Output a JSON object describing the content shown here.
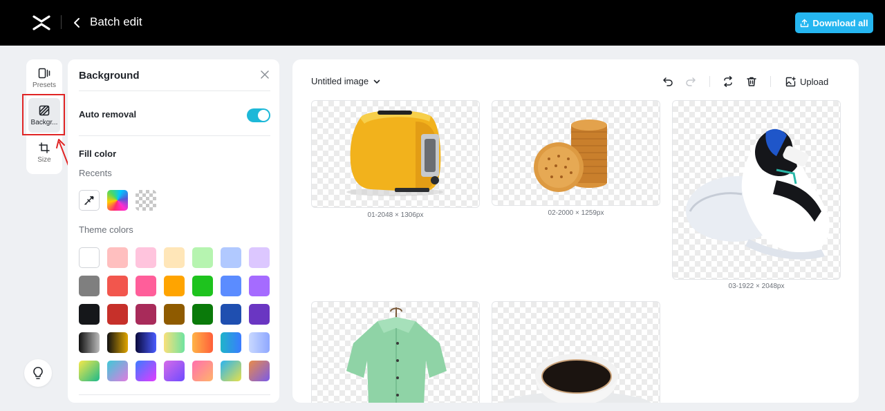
{
  "header": {
    "title": "Batch edit",
    "download_label": "Download all"
  },
  "rail": {
    "presets_label": "Presets",
    "background_label": "Backgr...",
    "size_label": "Size"
  },
  "panel": {
    "title": "Background",
    "auto_removal_label": "Auto removal",
    "auto_removal_on": true,
    "fill_color_label": "Fill color",
    "recents_label": "Recents",
    "theme_colors_label": "Theme colors",
    "theme_colors": [
      [
        "#ffffff",
        "#ffbfbf",
        "#ffc4dd",
        "#ffe6b8",
        "#b6f4b0",
        "#b1c9ff",
        "#dcc7ff"
      ],
      [
        "#7f7f7f",
        "#f2564d",
        "#ff5e9a",
        "#ffa400",
        "#1ec31e",
        "#5b8cff",
        "#a56bff"
      ],
      [
        "#15171a",
        "#c6302a",
        "#a82b5a",
        "#8f5b00",
        "#0a7a0a",
        "#1f4fb0",
        "#6a36c2"
      ],
      [
        "linear-gradient(90deg,#111,#bbb)",
        "linear-gradient(90deg,#111,#e0a600)",
        "linear-gradient(90deg,#0a0a3c,#4a5cff)",
        "linear-gradient(90deg,#f9e07a,#6ee3a0)",
        "linear-gradient(90deg,#ffb347,#ff5f3a)",
        "linear-gradient(90deg,#1fb4c9,#3a7bff)",
        "linear-gradient(90deg,#c8d8ff,#8fa8ff)"
      ],
      [
        "linear-gradient(135deg,#f5e84a,#1db98a)",
        "linear-gradient(135deg,#3ec9d6,#e07be0)",
        "linear-gradient(135deg,#3b7bff,#e23bff)",
        "linear-gradient(135deg,#d66be8,#6e4bff)",
        "linear-gradient(135deg,#ff6fae,#ffb36a)",
        "linear-gradient(135deg,#2bb3f0,#e6e04a)",
        "linear-gradient(135deg,#e88b4a,#7a5be8)"
      ]
    ]
  },
  "canvas": {
    "image_name": "Untitled image",
    "upload_label": "Upload",
    "images": [
      {
        "name": "toaster",
        "caption": "01-2048 × 1306px"
      },
      {
        "name": "cookies",
        "caption": "02-2000 × 1259px"
      },
      {
        "name": "sneaker",
        "caption": "03-1922 × 2048px"
      },
      {
        "name": "shirt",
        "caption": ""
      },
      {
        "name": "coffee",
        "caption": ""
      }
    ]
  },
  "colors": {
    "accent": "#25b6f0",
    "toggle": "#1db8d8",
    "highlight": "#e02424"
  }
}
